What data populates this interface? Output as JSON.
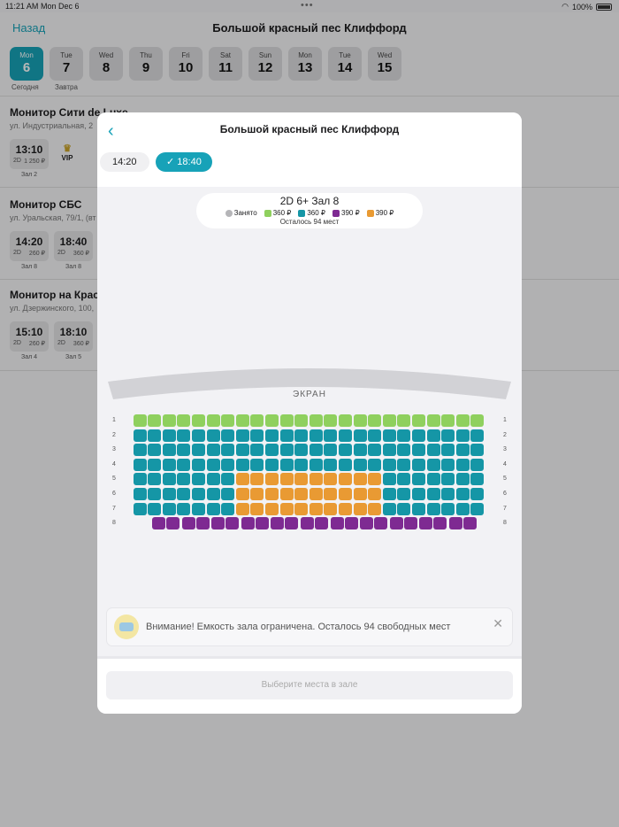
{
  "status": {
    "time": "11:21 AM",
    "date": "Mon Dec 6",
    "battery": "100%"
  },
  "nav": {
    "back": "Назад",
    "title": "Большой красный пес Клиффорд"
  },
  "dates": [
    {
      "dn": "Mon",
      "dd": "6",
      "active": true
    },
    {
      "dn": "Tue",
      "dd": "7"
    },
    {
      "dn": "Wed",
      "dd": "8"
    },
    {
      "dn": "Thu",
      "dd": "9"
    },
    {
      "dn": "Fri",
      "dd": "10"
    },
    {
      "dn": "Sat",
      "dd": "11"
    },
    {
      "dn": "Sun",
      "dd": "12"
    },
    {
      "dn": "Mon",
      "dd": "13"
    },
    {
      "dn": "Tue",
      "dd": "14"
    },
    {
      "dn": "Wed",
      "dd": "15"
    }
  ],
  "date_subs": {
    "today": "Сегодня",
    "tomorrow": "Завтра"
  },
  "cinemas": [
    {
      "name": "Монитор Сити de Luxe",
      "addr": "ул. Индустриальная, 2",
      "show_time": "13:10",
      "show_fmt": "2D",
      "show_price": "1 250 ₽",
      "hall": "Зал 2",
      "vip": "VIP"
    },
    {
      "name": "Монитор СБС",
      "addr": "ул. Уральская, 79/1, (вт",
      "shows": [
        {
          "time": "14:20",
          "fmt": "2D",
          "price": "260 ₽",
          "hall": "Зал 8"
        },
        {
          "time": "18:40",
          "fmt": "2D",
          "price": "360 ₽",
          "hall": "Зал 8"
        }
      ]
    },
    {
      "name": "Монитор на Крас",
      "addr": "ул. Дзержинского, 100,",
      "shows": [
        {
          "time": "15:10",
          "fmt": "2D",
          "price": "260 ₽",
          "hall": "Зал 4"
        },
        {
          "time": "18:10",
          "fmt": "2D",
          "price": "360 ₽",
          "hall": "Зал 5"
        }
      ]
    }
  ],
  "modal": {
    "title": "Большой красный пес Клиффорд",
    "times": {
      "off": "14:20",
      "on": "18:40"
    },
    "format_line": "2D  6+  Зал 8",
    "legend": {
      "taken": "Занято",
      "green": "360 ₽",
      "teal": "360 ₽",
      "purple": "390 ₽",
      "orange": "390 ₽"
    },
    "seats_left": "Осталось 94 мест",
    "screen": "ЭКРАН",
    "rows": [
      "1",
      "2",
      "3",
      "4",
      "5",
      "6",
      "7",
      "8"
    ],
    "notice": "Внимание! Емкость зала ограничена. Осталось 94 свободных мест",
    "choose": "Выберите места в зале"
  },
  "colors": {
    "accent": "#17a2b8",
    "green": "#8fd05e",
    "teal": "#1596a6",
    "orange": "#e99a33",
    "purple": "#7e2a92",
    "taken": "#b5b5b8"
  }
}
